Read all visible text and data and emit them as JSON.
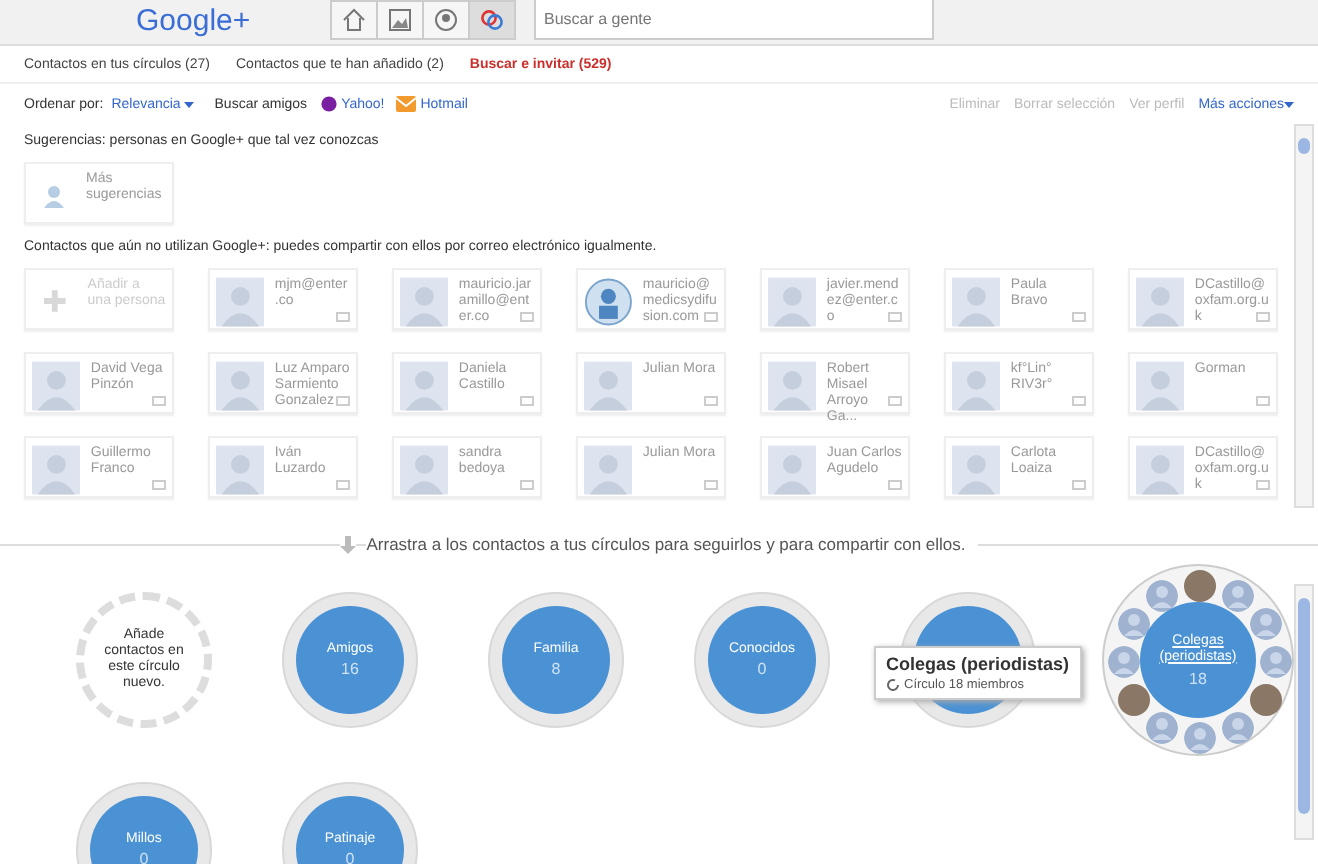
{
  "header": {
    "logo": "Google+",
    "nav_buttons": [
      {
        "kind": "home",
        "selected": false
      },
      {
        "kind": "photos",
        "selected": false
      },
      {
        "kind": "profile",
        "selected": false
      },
      {
        "kind": "circles",
        "selected": true
      }
    ],
    "search": {
      "placeholder": "Buscar a gente"
    }
  },
  "tabs": [
    {
      "label": "Contactos en tus círculos (27)",
      "selected": false
    },
    {
      "label": "Contactos que te han añadido (2)",
      "selected": false
    },
    {
      "label": "Buscar e invitar (529)",
      "selected": true
    }
  ],
  "toolbar": {
    "sort_label": "Ordenar por:",
    "sort_value": "Relevancia",
    "find_label": "Buscar amigos",
    "providers": [
      {
        "kind": "yahoo",
        "label": "Yahoo!"
      },
      {
        "kind": "hotmail",
        "label": "Hotmail"
      }
    ],
    "actions": [
      {
        "label": "Eliminar",
        "disabled": true
      },
      {
        "label": "Borrar selección",
        "disabled": true
      },
      {
        "label": "Ver perfil",
        "disabled": true
      },
      {
        "label": "Más acciones",
        "disabled": false
      }
    ]
  },
  "suggestions": {
    "title": "Sugerencias: personas en Google+ que tal vez conozcas",
    "more": "Más sugerencias"
  },
  "contacts": {
    "title": "Contactos que aún no utilizan Google+: puedes compartir con ellos por correo electrónico igualmente.",
    "add": "Añadir a una persona",
    "cards": [
      {
        "name": "mjm@enter.co",
        "kind": "person"
      },
      {
        "name": "mauricio.jaramillo@enter.co",
        "kind": "person"
      },
      {
        "name": "mauricio@medicsydifusion.com",
        "kind": "org"
      },
      {
        "name": "javier.mendez@enter.co",
        "kind": "person"
      },
      {
        "name": "Paula Bravo",
        "kind": "person"
      },
      {
        "name": "DCastillo@oxfam.org.uk",
        "kind": "person"
      },
      {
        "name": "David Vega Pinzón",
        "kind": "person"
      },
      {
        "name": "Luz Amparo Sarmiento Gonzalez",
        "kind": "person"
      },
      {
        "name": "Daniela Castillo",
        "kind": "person"
      },
      {
        "name": "Julian Mora",
        "kind": "person"
      },
      {
        "name": "Robert Misael Arroyo Ga...",
        "kind": "person"
      },
      {
        "name": "kf°Lin° RIV3r°",
        "kind": "person"
      },
      {
        "name": "Gorman",
        "kind": "person"
      },
      {
        "name": "Guillermo Franco",
        "kind": "person"
      },
      {
        "name": "Iván Luzardo",
        "kind": "person"
      },
      {
        "name": "sandra bedoya",
        "kind": "person"
      },
      {
        "name": "Julian Mora",
        "kind": "person"
      },
      {
        "name": "Juan Carlos Agudelo",
        "kind": "person"
      },
      {
        "name": "Carlota Loaiza",
        "kind": "person"
      },
      {
        "name": "DCastillo@oxfam.org.uk",
        "kind": "person"
      }
    ]
  },
  "drag_hint": "Arrastra a los contactos a tus círculos para seguirlos y para compartir con ellos.",
  "circles": [
    {
      "kind": "new",
      "text": "Añade contactos en este círculo nuevo."
    },
    {
      "kind": "circle",
      "name": "Amigos",
      "count": "16"
    },
    {
      "kind": "circle",
      "name": "Familia",
      "count": "8"
    },
    {
      "kind": "circle",
      "name": "Conocidos",
      "count": "0"
    },
    {
      "kind": "covered"
    },
    {
      "kind": "expanded",
      "name": "Colegas (periodistas)",
      "count": "18"
    },
    {
      "kind": "circle",
      "name": "Millos",
      "count": "0"
    },
    {
      "kind": "circle",
      "name": "Patinaje",
      "count": "0"
    }
  ],
  "tooltip": {
    "title": "Colegas (periodistas)",
    "subtitle": "Círculo 18 miembros"
  }
}
